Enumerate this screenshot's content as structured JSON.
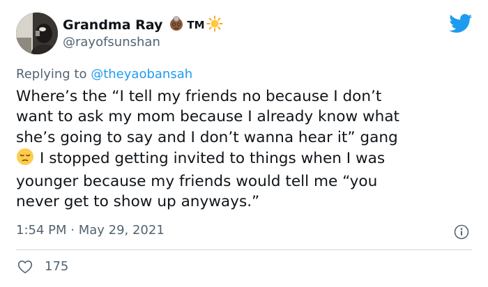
{
  "author": {
    "display_name": "Grandma Ray",
    "name_suffix": "TM",
    "handle": "@rayofsunshan"
  },
  "reply": {
    "prefix": "Replying to",
    "mention": "@theyaobansah"
  },
  "tweet": {
    "lines": [
      "Where’s the “I tell my friends no because I don’t",
      "want to ask my mom because I already know what",
      "she’s going to say and I don’t wanna hear it” gang",
      "I stopped getting invited to things when I was",
      "younger because my friends would tell me “you",
      "never get to show up anyways.”"
    ]
  },
  "meta": {
    "timestamp": "1:54 PM · May 29, 2021"
  },
  "engagement": {
    "likes": "175"
  },
  "colors": {
    "twitter_blue": "#1d9bf0",
    "secondary_text": "#536471",
    "primary_text": "#0f1419",
    "divider": "#cfd9de"
  },
  "icons": {
    "brand": "twitter-bird-icon",
    "info": "info-icon",
    "like": "heart-outline-icon",
    "name_emojis": [
      "grandma-emoji",
      "sun-emoji"
    ],
    "text_emoji": "pensive-face-emoji"
  }
}
